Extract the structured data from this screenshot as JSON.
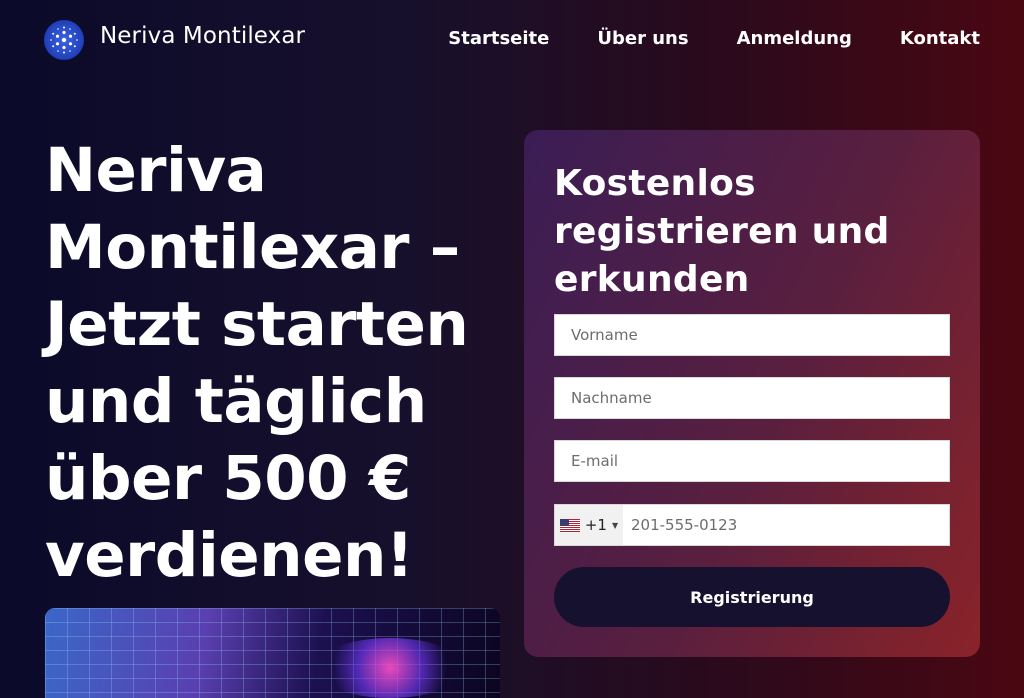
{
  "header": {
    "brand": "Neriva Montilexar",
    "nav": [
      "Startseite",
      "Über uns",
      "Anmeldung",
      "Kontakt"
    ]
  },
  "hero": {
    "title": "Neriva Montilexar – Jetzt starten und täglich über 500 € verdienen!"
  },
  "form": {
    "title": "Kostenlos registrieren und erkunden",
    "first_name_placeholder": "Vorname",
    "last_name_placeholder": "Nachname",
    "email_placeholder": "E-mail",
    "country_code": "+1",
    "phone_placeholder": "201-555-0123",
    "submit_label": "Registrierung"
  },
  "colors": {
    "accent_button": "#15112f",
    "logo_blue": "#1f3fb8"
  },
  "icons": {
    "logo": "cardano-style-dots-logo",
    "flag": "us-flag-icon",
    "caret": "caret-down-icon"
  }
}
